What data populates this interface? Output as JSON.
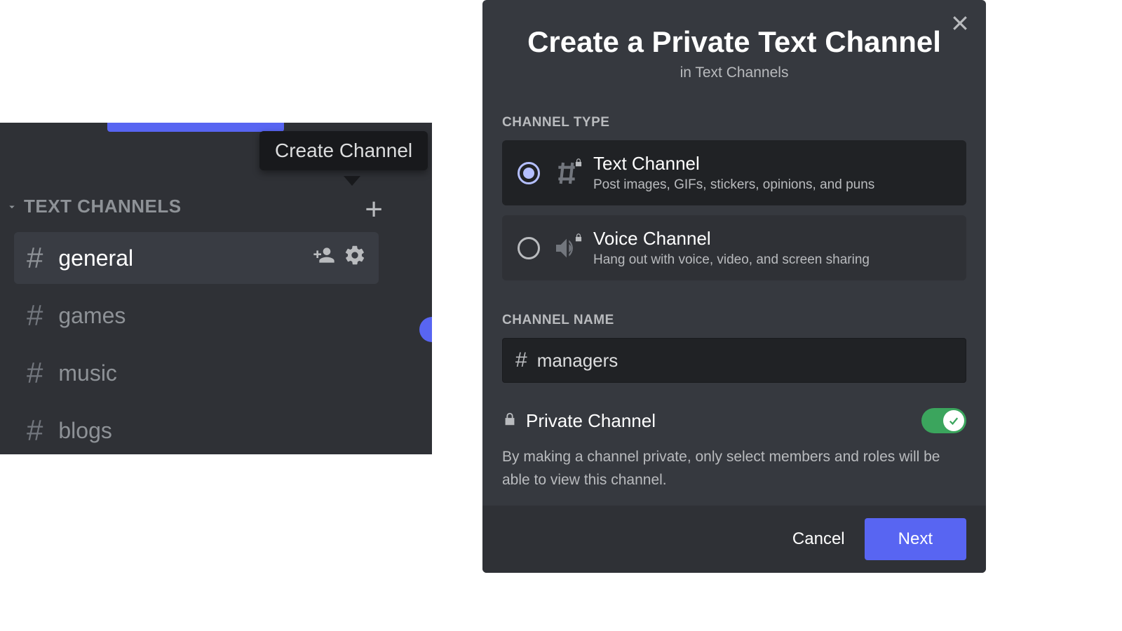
{
  "sidebar": {
    "tooltip": "Create Channel",
    "category_label": "TEXT CHANNELS",
    "channels": [
      {
        "name": "general"
      },
      {
        "name": "games"
      },
      {
        "name": "music"
      },
      {
        "name": "blogs"
      }
    ]
  },
  "modal": {
    "title": "Create a Private Text Channel",
    "subtitle": "in Text Channels",
    "section_type_label": "CHANNEL TYPE",
    "types": {
      "text": {
        "title": "Text Channel",
        "desc": "Post images, GIFs, stickers, opinions, and puns"
      },
      "voice": {
        "title": "Voice Channel",
        "desc": "Hang out with voice, video, and screen sharing"
      }
    },
    "section_name_label": "CHANNEL NAME",
    "channel_name_value": "managers",
    "private_label": "Private Channel",
    "private_desc": "By making a channel private, only select members and roles will be able to view this channel.",
    "private_enabled": true,
    "cancel": "Cancel",
    "next": "Next"
  }
}
